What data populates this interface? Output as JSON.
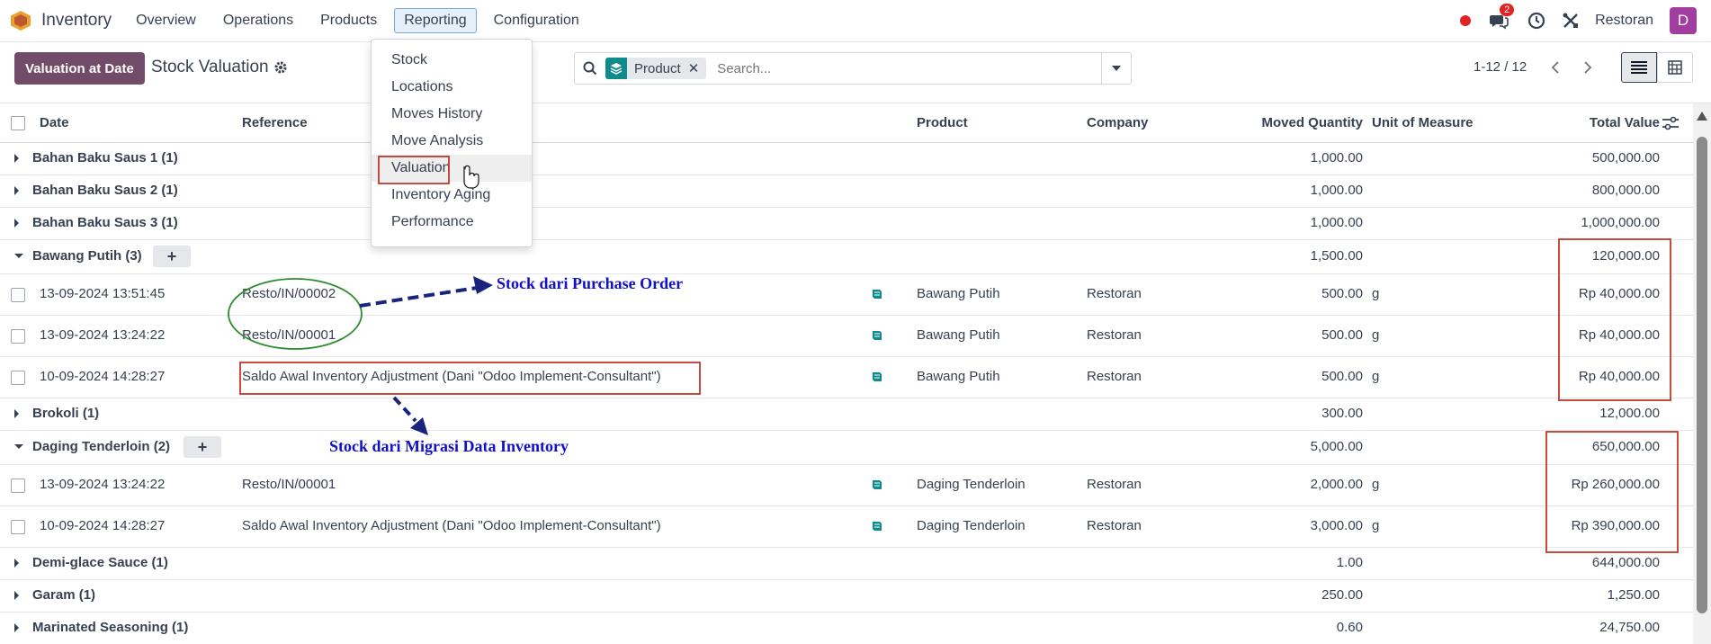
{
  "navbar": {
    "app_name": "Inventory",
    "menu": [
      "Overview",
      "Operations",
      "Products",
      "Reporting",
      "Configuration"
    ],
    "active_menu": "Reporting",
    "chat_count": "2",
    "company": "Restoran",
    "avatar_letter": "D"
  },
  "control": {
    "valuation_button": "Valuation at Date",
    "title": "Stock Valuation",
    "facet_label": "Product",
    "facet_remove": "✕",
    "search_placeholder": "Search...",
    "pager": "1-12 / 12"
  },
  "table": {
    "headers": {
      "date": "Date",
      "reference": "Reference",
      "product": "Product",
      "company": "Company",
      "moved_quantity": "Moved Quantity",
      "unit": "Unit of Measure",
      "total_value": "Total Value"
    },
    "rows": [
      {
        "type": "group",
        "label": "Bahan Baku Saus 1 (1)",
        "expanded": false,
        "qty": "1,000.00",
        "value": "500,000.00"
      },
      {
        "type": "group",
        "label": "Bahan Baku Saus 2 (1)",
        "expanded": false,
        "qty": "1,000.00",
        "value": "800,000.00"
      },
      {
        "type": "group",
        "label": "Bahan Baku Saus 3 (1)",
        "expanded": false,
        "qty": "1,000.00",
        "value": "1,000,000.00"
      },
      {
        "type": "group",
        "label": "Bawang Putih (3)",
        "expanded": true,
        "qty": "1,500.00",
        "value": "120,000.00"
      },
      {
        "type": "record",
        "date": "13-09-2024 13:51:45",
        "reference": "Resto/IN/00002",
        "product": "Bawang Putih",
        "company": "Restoran",
        "qty": "500.00",
        "unit": "g",
        "value": "Rp 40,000.00"
      },
      {
        "type": "record",
        "date": "13-09-2024 13:24:22",
        "reference": "Resto/IN/00001",
        "product": "Bawang Putih",
        "company": "Restoran",
        "qty": "500.00",
        "unit": "g",
        "value": "Rp 40,000.00"
      },
      {
        "type": "record",
        "date": "10-09-2024 14:28:27",
        "reference": "Saldo Awal Inventory Adjustment (Dani \"Odoo Implement-Consultant\")",
        "product": "Bawang Putih",
        "company": "Restoran",
        "qty": "500.00",
        "unit": "g",
        "value": "Rp 40,000.00"
      },
      {
        "type": "group",
        "label": "Brokoli (1)",
        "expanded": false,
        "qty": "300.00",
        "value": "12,000.00"
      },
      {
        "type": "group",
        "label": "Daging Tenderloin (2)",
        "expanded": true,
        "qty": "5,000.00",
        "value": "650,000.00"
      },
      {
        "type": "record",
        "date": "13-09-2024 13:24:22",
        "reference": "Resto/IN/00001",
        "product": "Daging Tenderloin",
        "company": "Restoran",
        "qty": "2,000.00",
        "unit": "g",
        "value": "Rp 260,000.00"
      },
      {
        "type": "record",
        "date": "10-09-2024 14:28:27",
        "reference": "Saldo Awal Inventory Adjustment (Dani \"Odoo Implement-Consultant\")",
        "product": "Daging Tenderloin",
        "company": "Restoran",
        "qty": "3,000.00",
        "unit": "g",
        "value": "Rp 390,000.00"
      },
      {
        "type": "group",
        "label": "Demi-glace Sauce (1)",
        "expanded": false,
        "qty": "1.00",
        "value": "644,000.00"
      },
      {
        "type": "group",
        "label": "Garam (1)",
        "expanded": false,
        "qty": "250.00",
        "value": "1,250.00"
      },
      {
        "type": "group",
        "label": "Marinated Seasoning (1)",
        "expanded": false,
        "qty": "0.60",
        "value": "24,750.00"
      }
    ]
  },
  "reporting_dropdown": {
    "items": [
      "Stock",
      "Locations",
      "Moves History",
      "Move Analysis",
      "Valuation",
      "Inventory Aging",
      "Performance"
    ],
    "highlighted": "Valuation"
  },
  "annotations": {
    "purchase_order": "Stock dari Purchase Order",
    "migration": "Stock dari Migrasi Data Inventory"
  },
  "colors": {
    "brand": "#714b67",
    "annotation_text": "#1010c8",
    "annotation_box": "#c0392b",
    "ellipse": "#2e8b2e",
    "arrow": "#1a237e"
  }
}
